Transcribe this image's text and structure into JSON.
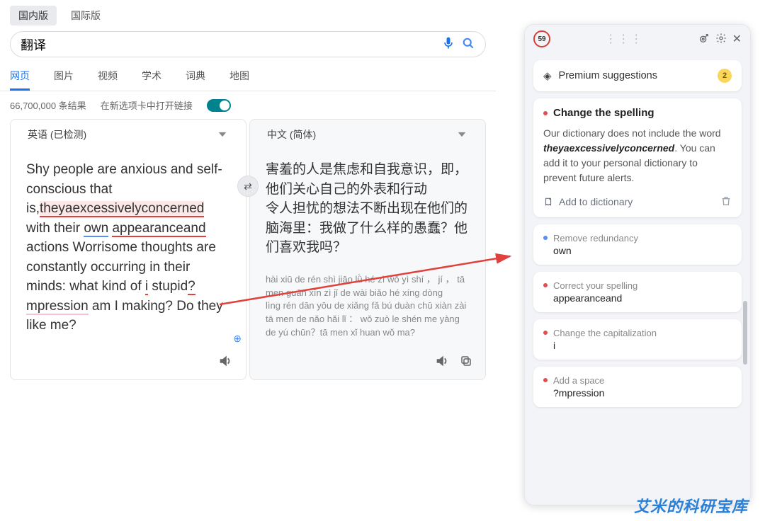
{
  "version_tabs": {
    "domestic": "国内版",
    "international": "国际版"
  },
  "search": {
    "value": "翻译"
  },
  "nav": {
    "web": "网页",
    "image": "图片",
    "video": "视频",
    "scholar": "学术",
    "dict": "词典",
    "map": "地图"
  },
  "results": {
    "count": "66,700,000 条结果",
    "newtab_label": "在新选项卡中打开链接"
  },
  "source_lang": "英语 (已检测)",
  "target_lang": "中文 (简体)",
  "source_text": {
    "seg1": "Shy people are anxious and self-conscious that is,",
    "seg2_err": "theyaexcessivelyconcerned",
    "seg3": " with their ",
    "seg4_own": "own",
    "seg5": " ",
    "seg6_app": "appearanceand",
    "seg7": " actions Worrisome thoughts are constantly occurring in their minds: what kind of ",
    "seg8_i": "i",
    "seg9": " stupid",
    "seg10_q": "?",
    "seg11_mp": "mpression",
    "seg12": " am I making? Do they like me?"
  },
  "target_text": {
    "p1": "害羞的人是焦虑和自我意识，即，他们关心自己的外表和行动",
    "p2": "令人担忧的想法不断出现在他们的脑海里：我做了什么样的愚蠢？他们喜欢我吗？"
  },
  "pinyin": "hài xiū de rén shì jiāo lǜ hé zì wǒ yì shí ， jí ， tā men guān xīn zì jǐ de wài biǎo hé xíng dòng\nlìng rén dān yōu de xiǎng fǎ bú duàn chū xiàn zài tā men de nǎo hǎi lǐ ： wǒ zuò le shén me yàng de yú chūn？tā men xǐ huan wǒ ma?",
  "assistant": {
    "score": "59",
    "premium_label": "Premium suggestions",
    "premium_count": "2",
    "main_card": {
      "title": "Change the spelling",
      "desc1": "Our dictionary does not include the word ",
      "word": "theyaexcessivelyconcerned",
      "desc2": ". You can add it to your personal dictionary to prevent future alerts.",
      "add_btn": "Add to dictionary"
    },
    "sug2": {
      "label": "Remove redundancy",
      "value": "own"
    },
    "sug3": {
      "label": "Correct your spelling",
      "value": "appearanceand"
    },
    "sug4": {
      "label": "Change the capitalization",
      "value": "i"
    },
    "sug5": {
      "label": "Add a space",
      "value": "?mpression"
    }
  },
  "watermark": "艾米的科研宝库"
}
